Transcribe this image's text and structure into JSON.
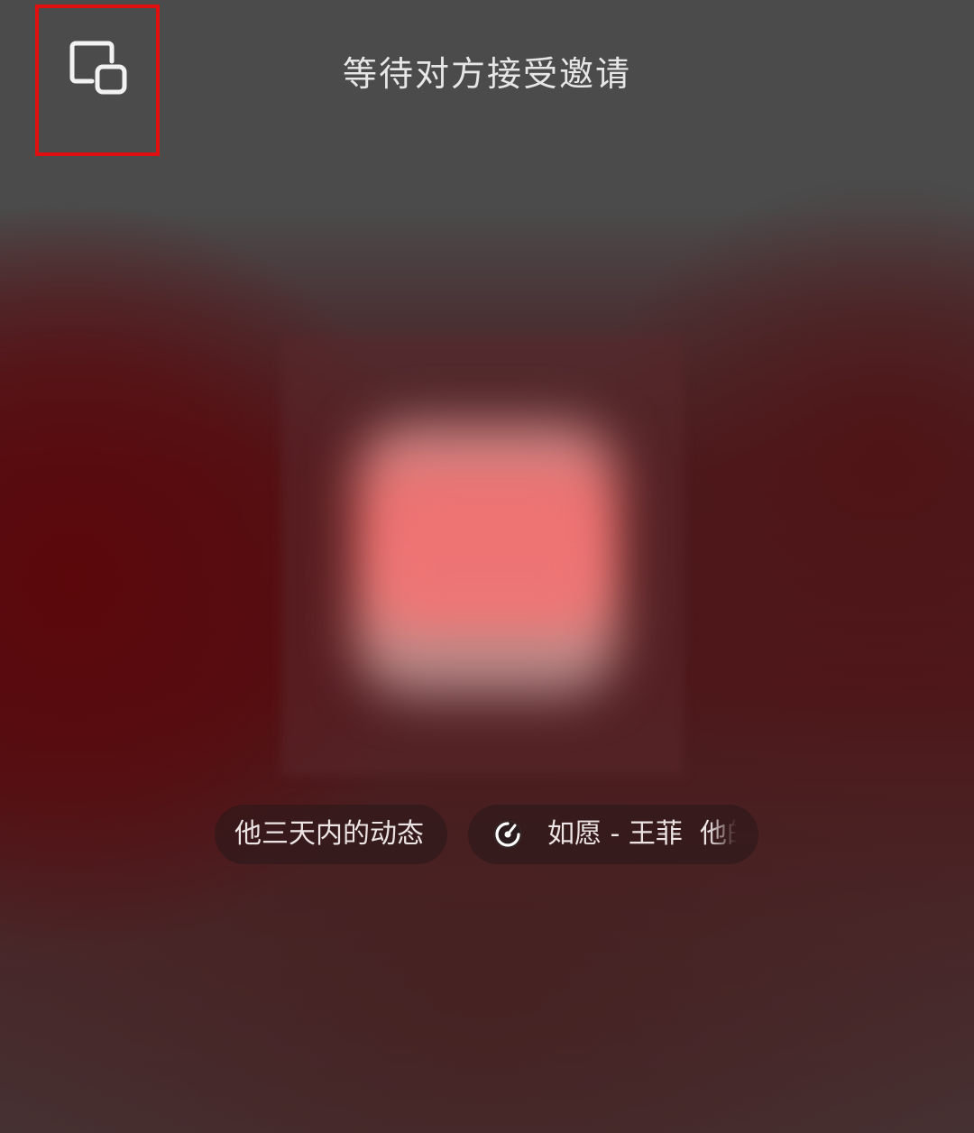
{
  "header": {
    "title": "等待对方接受邀请",
    "minimize_icon": "picture-in-picture-icon"
  },
  "chips": {
    "moments_label": "他三天内的动态",
    "music_icon": "music-disc-icon",
    "music_label": "如愿 - 王菲  他的"
  },
  "colors": {
    "highlight_border": "#e01010",
    "text": "#e6e6e6",
    "accent_red": "#ec7473"
  }
}
